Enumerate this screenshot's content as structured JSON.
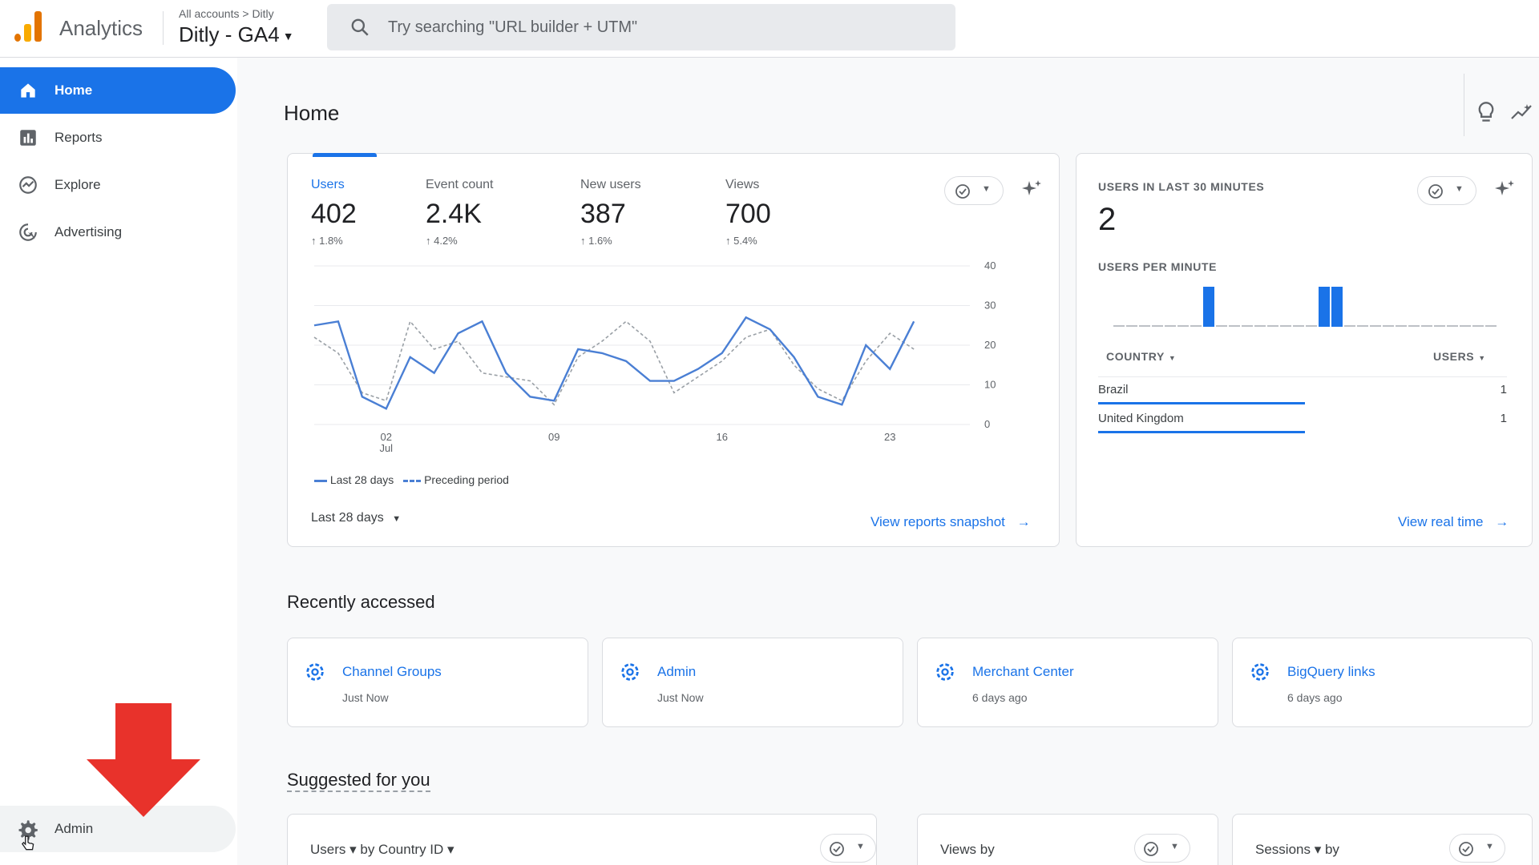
{
  "header": {
    "app_name": "Analytics",
    "breadcrumb": "All accounts > Ditly",
    "property": "Ditly - GA4",
    "search_placeholder": "Try searching \"URL builder + UTM\""
  },
  "sidebar": {
    "items": [
      {
        "label": "Home",
        "icon": "home-icon",
        "active": true
      },
      {
        "label": "Reports",
        "icon": "reports-icon"
      },
      {
        "label": "Explore",
        "icon": "explore-icon"
      },
      {
        "label": "Advertising",
        "icon": "advertising-icon"
      }
    ],
    "admin_label": "Admin"
  },
  "page_title": "Home",
  "overview": {
    "metrics": [
      {
        "label": "Users",
        "value": "402",
        "change": "↑ 1.8%"
      },
      {
        "label": "Event count",
        "value": "2.4K",
        "change": "↑ 4.2%"
      },
      {
        "label": "New users",
        "value": "387",
        "change": "↑ 1.6%"
      },
      {
        "label": "Views",
        "value": "700",
        "change": "↑ 5.4%"
      }
    ],
    "date_range": "Last 28 days",
    "link": "View reports snapshot"
  },
  "chart_data": {
    "type": "line",
    "x_ticks": [
      {
        "day": 2,
        "label": "02",
        "sublabel": "Jul"
      },
      {
        "day": 9,
        "label": "09"
      },
      {
        "day": 16,
        "label": "16"
      },
      {
        "day": 23,
        "label": "23"
      }
    ],
    "y_ticks": [
      0,
      10,
      20,
      30,
      40
    ],
    "ylim": [
      0,
      40
    ],
    "x": [
      -1,
      0,
      1,
      2,
      3,
      4,
      5,
      6,
      7,
      8,
      9,
      10,
      11,
      12,
      13,
      14,
      15,
      16,
      17,
      18,
      19,
      20,
      21,
      22,
      23,
      24,
      25,
      26
    ],
    "series": [
      {
        "name": "Last 28 days",
        "style": "solid",
        "color": "#4a7fd4",
        "values": [
          25,
          26,
          7,
          4,
          17,
          13,
          23,
          26,
          13,
          7,
          6,
          19,
          18,
          16,
          11,
          11,
          14,
          18,
          27,
          24,
          17,
          7,
          5,
          20,
          14,
          26
        ]
      },
      {
        "name": "Preceding period",
        "style": "dashed",
        "color": "#9aa0a6",
        "values": [
          22,
          18,
          8,
          6,
          26,
          19,
          21,
          13,
          12,
          11,
          5,
          17,
          21,
          26,
          21,
          8,
          12,
          16,
          22,
          24,
          15,
          9,
          6,
          16,
          23,
          19
        ]
      }
    ]
  },
  "realtime": {
    "title": "USERS IN LAST 30 MINUTES",
    "value": "2",
    "per_minute_label": "USERS PER MINUTE",
    "per_minute_values": [
      0,
      0,
      0,
      0,
      0,
      0,
      0,
      1,
      0,
      0,
      0,
      0,
      0,
      0,
      0,
      0,
      1,
      1,
      0,
      0,
      0,
      0,
      0,
      0,
      0,
      0,
      0,
      0,
      0,
      0
    ],
    "country_header": "COUNTRY",
    "users_header": "USERS",
    "rows": [
      {
        "country": "Brazil",
        "users": "1"
      },
      {
        "country": "United Kingdom",
        "users": "1"
      }
    ],
    "link": "View real time"
  },
  "recent": {
    "title": "Recently accessed",
    "items": [
      {
        "title": "Channel Groups",
        "sub": "Just Now"
      },
      {
        "title": "Admin",
        "sub": "Just Now"
      },
      {
        "title": "Merchant Center",
        "sub": "6 days ago"
      },
      {
        "title": "BigQuery links",
        "sub": "6 days ago"
      }
    ]
  },
  "suggested": {
    "title": "Suggested for you",
    "cards": [
      {
        "text": "Users ▾  by Country ID ▾"
      },
      {
        "text": "Views by"
      },
      {
        "text": "Sessions ▾  by"
      }
    ]
  },
  "colors": {
    "accent": "#1a73e8",
    "arrow": "#e8322b"
  }
}
